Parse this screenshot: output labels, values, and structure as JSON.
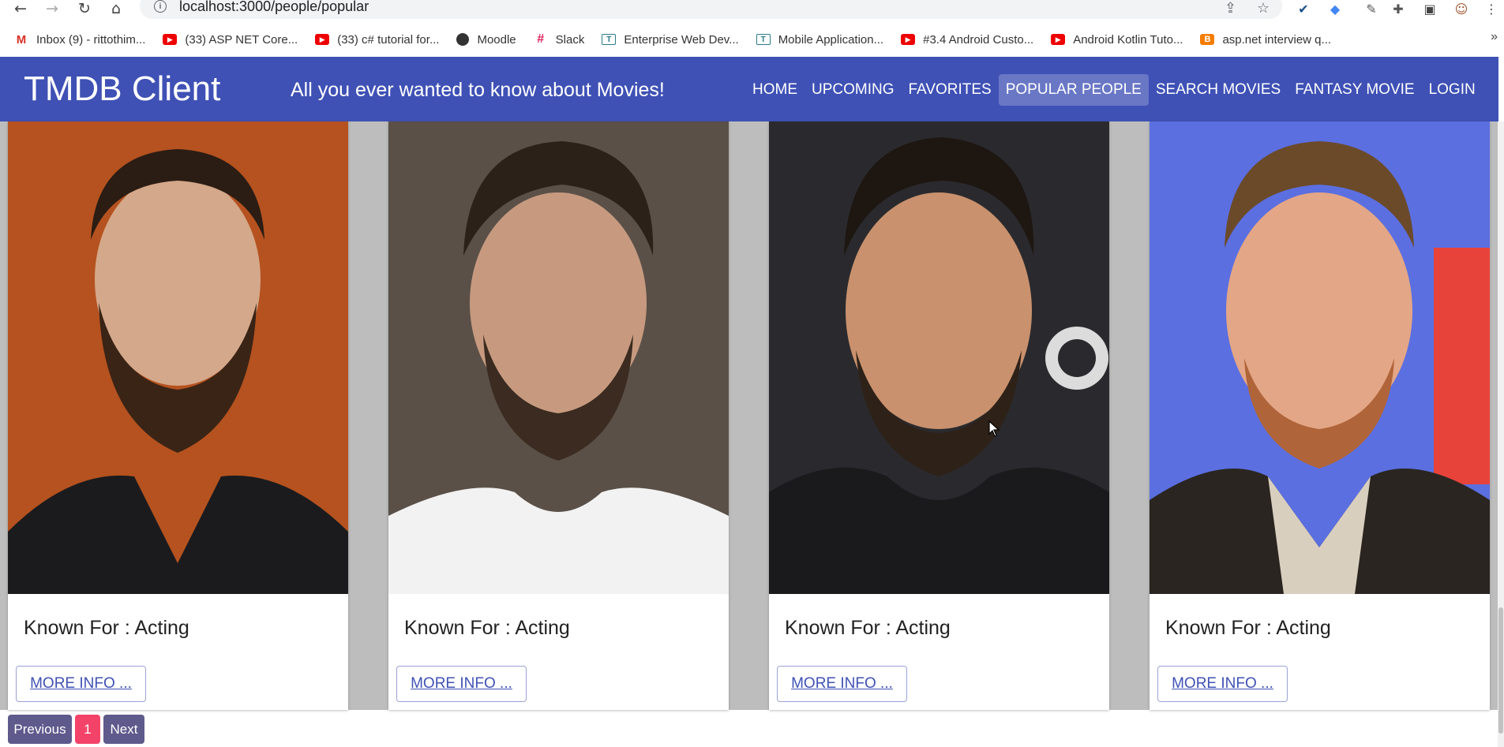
{
  "browser": {
    "url": "localhost:3000/people/popular",
    "bookmarks": [
      {
        "label": "Inbox (9) - rittothim...",
        "icon": "gmail-icon"
      },
      {
        "label": "(33) ASP NET Core...",
        "icon": "youtube-icon"
      },
      {
        "label": "(33) c# tutorial for...",
        "icon": "youtube-icon"
      },
      {
        "label": "Moodle",
        "icon": "globe-icon"
      },
      {
        "label": "Slack",
        "icon": "slack-icon"
      },
      {
        "label": "Enterprise Web Dev...",
        "icon": "classroom-icon"
      },
      {
        "label": "Mobile Application...",
        "icon": "classroom-icon"
      },
      {
        "label": "#3.4 Android Custo...",
        "icon": "youtube-icon"
      },
      {
        "label": "Android Kotlin Tuto...",
        "icon": "youtube-icon"
      },
      {
        "label": "asp.net interview q...",
        "icon": "blogger-icon"
      }
    ]
  },
  "header": {
    "brand": "TMDB Client",
    "tagline": "All you ever wanted to know about Movies!",
    "nav": [
      {
        "label": "Home",
        "active": false
      },
      {
        "label": "Upcoming",
        "active": false
      },
      {
        "label": "Favorites",
        "active": false
      },
      {
        "label": "Popular People",
        "active": true
      },
      {
        "label": "Search Movies",
        "active": false
      },
      {
        "label": "Fantasy Movie",
        "active": false
      },
      {
        "label": "Login",
        "active": false
      }
    ]
  },
  "cards": [
    {
      "known_for": "Known For : Acting",
      "button": "More Info ...",
      "bg": "#b5521f"
    },
    {
      "known_for": "Known For : Acting",
      "button": "More Info ...",
      "bg": "#5a5048"
    },
    {
      "known_for": "Known For : Acting",
      "button": "More Info ...",
      "bg": "#2a2a2e"
    },
    {
      "known_for": "Known For : Acting",
      "button": "More Info ...",
      "bg": "#5b6fe0"
    }
  ],
  "pagination": {
    "previous": "Previous",
    "current": "1",
    "next": "Next"
  },
  "colors": {
    "appbar": "#3f51b5",
    "pager_button": "#5e5a8c",
    "current_page": "#f44369"
  }
}
